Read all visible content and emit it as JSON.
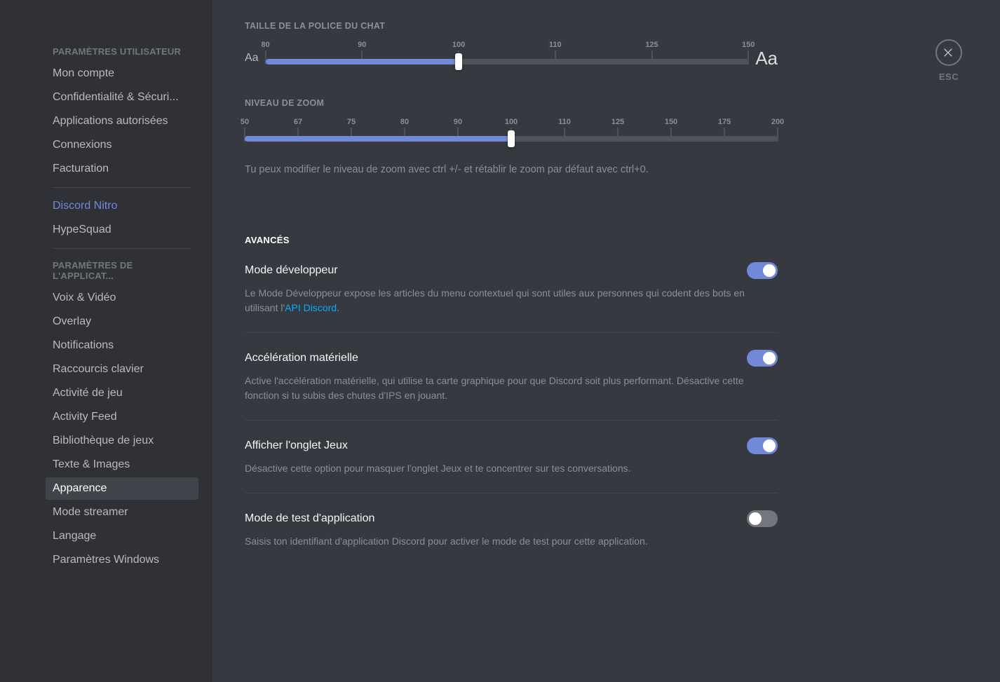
{
  "sidebar": {
    "header1": "PARAMÈTRES UTILISATEUR",
    "group1": [
      "Mon compte",
      "Confidentialité & Sécuri...",
      "Applications autorisées",
      "Connexions",
      "Facturation"
    ],
    "group2": [
      "Discord Nitro",
      "HypeSquad"
    ],
    "header2": "PARAMÈTRES DE L'APPLICAT...",
    "group3": [
      "Voix & Vidéo",
      "Overlay",
      "Notifications",
      "Raccourcis clavier",
      "Activité de jeu",
      "Activity Feed",
      "Bibliothèque de jeux",
      "Texte & Images",
      "Apparence",
      "Mode streamer",
      "Langage",
      "Paramètres Windows"
    ],
    "activeItem": "Apparence",
    "nitroItem": "Discord Nitro"
  },
  "close": {
    "label": "ESC"
  },
  "fontSlider": {
    "label": "TAILLE DE LA POLICE DU CHAT",
    "smallAa": "Aa",
    "largeAa": "Aa",
    "ticks": [
      80,
      90,
      100,
      110,
      125,
      150
    ],
    "min": 80,
    "max": 150,
    "value": 100
  },
  "zoomSlider": {
    "label": "NIVEAU DE ZOOM",
    "ticks": [
      50,
      67,
      75,
      80,
      90,
      100,
      110,
      125,
      150,
      175,
      200
    ],
    "min": 50,
    "max": 200,
    "value": 100,
    "hint": "Tu peux modifier le niveau de zoom avec ctrl +/- et rétablir le zoom par défaut avec ctrl+0."
  },
  "advanced": {
    "title": "AVANCÉS",
    "items": [
      {
        "title": "Mode développeur",
        "descPre": "Le Mode Développeur expose les articles du menu contextuel qui sont utiles aux personnes qui codent des bots en utilisant l'",
        "link": "API Discord",
        "descPost": ".",
        "on": true
      },
      {
        "title": "Accélération matérielle",
        "desc": "Active l'accélération matérielle, qui utilise ta carte graphique pour que Discord soit plus performant. Désactive cette fonction si tu subis des chutes d'IPS en jouant.",
        "on": true
      },
      {
        "title": "Afficher l'onglet Jeux",
        "desc": "Désactive cette option pour masquer l'onglet Jeux et te concentrer sur tes conversations.",
        "on": true
      },
      {
        "title": "Mode de test d'application",
        "desc": "Saisis ton identifiant d'application Discord pour activer le mode de test pour cette application.",
        "on": false
      }
    ]
  }
}
